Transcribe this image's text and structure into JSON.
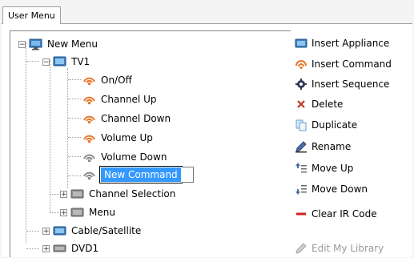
{
  "tab": {
    "label": "User Menu"
  },
  "tree": {
    "root": "New Menu",
    "tv1": "TV1",
    "commands": [
      "On/Off",
      "Channel Up",
      "Channel Down",
      "Volume Up",
      "Volume Down"
    ],
    "editing": "New Command",
    "tv1_children": [
      "Channel Selection",
      "Menu"
    ],
    "others": [
      "Cable/Satellite",
      "DVD1"
    ]
  },
  "actions": {
    "insert_appliance": "Insert Appliance",
    "insert_command": "Insert Command",
    "insert_sequence": "Insert Sequence",
    "delete": "Delete",
    "duplicate": "Duplicate",
    "rename": "Rename",
    "move_up": "Move Up",
    "move_down": "Move Down",
    "clear_ir_code": "Clear IR Code",
    "edit_my_library": "Edit My Library"
  },
  "colors": {
    "selection": "#3399ff",
    "ir_orange": "#e8762b",
    "ir_gray": "#8a8a8a",
    "delete_red": "#c0392b",
    "clear_red": "#d42020"
  }
}
